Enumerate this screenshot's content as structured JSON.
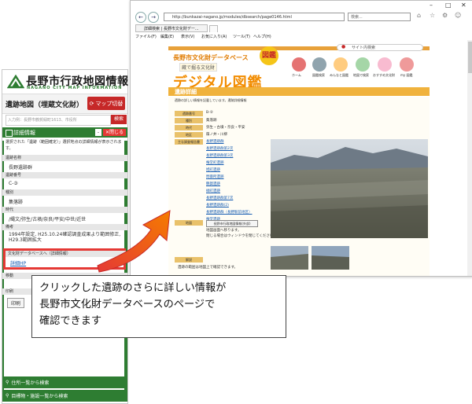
{
  "left_app": {
    "title": "長野市行政地図情報",
    "subtitle": "NAGANO CITY MAP INFORMATION",
    "layer_name": "遺跡地図（埋蔵文化財）",
    "map_switch_label": "マップ切替",
    "search_placeholder": "入力例：長野市鶴賀緑町1613、市役所",
    "search_button": "検索",
    "detail_panel_title": "詳細情報",
    "close_label": "閉じる",
    "minimize_label": "-",
    "note": "選択された「遺跡（範囲確定）」選択地点の詳細情報が表示されます。",
    "fields": [
      {
        "label": "遺跡名称",
        "value": "長野遺跡群"
      },
      {
        "label": "遺跡番号",
        "value": "C-③"
      },
      {
        "label": "種別",
        "value": "集落跡"
      },
      {
        "label": "時代",
        "value": "/縄文/弥生/古墳/奈良/平安/中世/近世"
      },
      {
        "label": "備考",
        "value": "1994年設定, H25.10.24確認調査成果より範囲修正, H29.3範囲拡大"
      }
    ],
    "db_link_header": "文化財データベースへ（詳細情報）",
    "db_link_text": "詳細HP",
    "extra_label_1": "移動",
    "extra_label_2": "印刷",
    "extra_button": "印刷",
    "bottom_btn_1": "住所一覧から検索",
    "bottom_btn_2": "目標物・施設一覧から検索"
  },
  "browser": {
    "url": "http://bunkazai-nagano.jp/modules/dbsearch/page0146.html",
    "search_placeholder": "検索...",
    "tab_title": "詳細検索 | 長野市文化財デー...",
    "menu": [
      "ファイル(F)",
      "編集(E)",
      "表示(V)",
      "お気に入り(A)",
      "ツール(T)",
      "ヘルプ(H)"
    ],
    "page": {
      "db_title": "長野市文化財データベース",
      "db_subtitle": "蔵で掘る文化財",
      "digital_title": "デジタル図鑑",
      "badge": "図鑑",
      "site_search": "サイト内検索",
      "nav": [
        "ホーム",
        "図鑑検索",
        "みんなと図鑑",
        "地図で検索",
        "おすすめ文化財",
        "my 図鑑"
      ],
      "section_title": "遺跡詳細",
      "description": "遺跡の詳しい情報を記載しています。遺跡詳細情報",
      "rows": [
        {
          "label": "遺跡番号",
          "value": "B-②"
        },
        {
          "label": "種別",
          "value": "集落跡"
        },
        {
          "label": "時代",
          "value": "弥生・古墳・奈良・平安"
        },
        {
          "label": "地区",
          "value": "篠ノ井・川柳"
        }
      ],
      "report_label": "主な調査報告書",
      "reports": [
        "長野遺跡群",
        "長野遺跡群第2次",
        "長野遺跡群第3次",
        "権堂町遺跡",
        "旭町遺跡",
        "問御所遺跡",
        "鶴賀遺跡",
        "緑町遺跡",
        "長野遺跡群第7次",
        "長野遺跡群(2)",
        "長野遺跡群（長野駅前地区）",
        "権堂遺跡"
      ],
      "map_label": "地図",
      "map_button": "長野市行政地図情報(外部)",
      "map_note_1": "地図画面へ移ります。",
      "map_note_2": "閉じる場合はウィンドウを閉じてください",
      "footer_label": "解説",
      "footer_text": "遺跡の範囲は地図上で確認できます。"
    }
  },
  "callout": {
    "lines": [
      "クリックした遺跡のさらに詳しい情報が",
      "長野市文化財データベースのページで",
      "確認できます"
    ]
  },
  "colors": {
    "green": "#2e7d32",
    "red": "#e53935",
    "orange": "#f28c00",
    "link": "#1a5fb4",
    "arrow": "#ef5a12"
  }
}
